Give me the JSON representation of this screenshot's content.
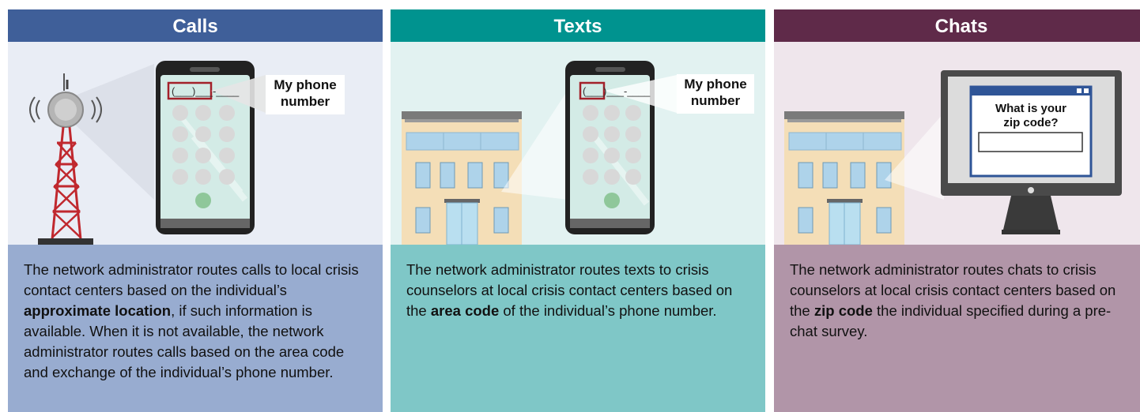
{
  "panels": [
    {
      "title": "Calls",
      "tag": [
        "My phone",
        "number"
      ],
      "desc": {
        "pre": "The network administrator routes calls to local crisis contact centers based on the individual’s ",
        "bold": "approximate location",
        "post": ", if such information is available. When it is not available, the network administrator routes calls based on the area code and exchange of the individual’s phone number."
      }
    },
    {
      "title": "Texts",
      "tag": [
        "My phone",
        "number"
      ],
      "desc": {
        "pre": "The network administrator routes texts to crisis counselors at local crisis contact centers based on the ",
        "bold": "area code",
        "post": " of the individual’s phone number."
      }
    },
    {
      "title": "Chats",
      "screen_question": [
        "What is your",
        "zip code?"
      ],
      "desc": {
        "pre": "The network administrator routes chats to crisis counselors at local crisis contact centers based on the ",
        "bold": "zip code",
        "post": " the individual specified during a pre-chat survey."
      }
    }
  ],
  "phone_field": "(___)___-____",
  "colors": {
    "calls_header": "#3f5f99",
    "texts_header": "#00938f",
    "chats_header": "#5f2a49",
    "tower_red": "#c0282e",
    "call_button": "#8fc79a",
    "highlight_red": "#a3212a"
  },
  "icons": [
    "cell-tower-icon",
    "smartphone-icon",
    "building-icon",
    "computer-monitor-icon"
  ]
}
